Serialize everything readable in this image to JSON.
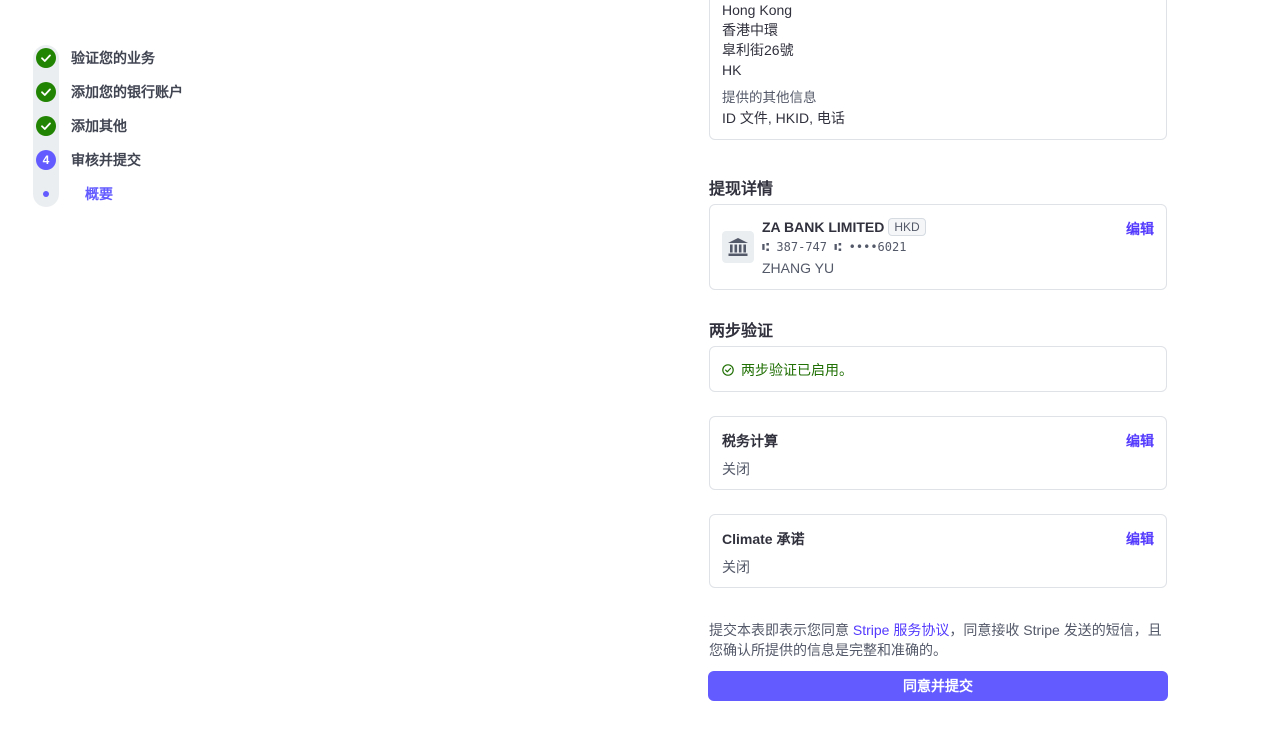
{
  "stepper": {
    "steps": [
      {
        "label": "验证您的业务",
        "status": "done"
      },
      {
        "label": "添加您的银行账户",
        "status": "done"
      },
      {
        "label": "添加其他",
        "status": "done"
      },
      {
        "label": "审核并提交",
        "status": "current",
        "number": "4"
      }
    ],
    "substep": {
      "label": "概要"
    }
  },
  "address_card": {
    "lines": [
      "Hong Kong",
      "香港中環",
      "皐利街26號",
      "HK"
    ],
    "other_info_label": "提供的其他信息",
    "other_info_value": "ID 文件, HKID, 电话"
  },
  "payout": {
    "title": "提现详情",
    "bank_name": "ZA BANK LIMITED",
    "currency": "HKD",
    "account_number": "⑆ 387-747 ⑆ ••••6021",
    "account_holder": "ZHANG YU",
    "edit_label": "编辑"
  },
  "two_factor": {
    "title": "两步验证",
    "status_text": "两步验证已启用。"
  },
  "tax": {
    "title": "税务计算",
    "value": "关闭",
    "edit_label": "编辑"
  },
  "climate": {
    "title": "Climate 承诺",
    "value": "关闭",
    "edit_label": "编辑"
  },
  "agreement": {
    "text_before": "提交本表即表示您同意 ",
    "link_text": "Stripe 服务协议",
    "text_after": "，同意接收 Stripe 发送的短信，且您确认所提供的信息是完整和准确的。"
  },
  "submit": {
    "label": "同意并提交"
  },
  "colors": {
    "accent": "#635bff",
    "success": "#228403",
    "link": "#533afd"
  }
}
